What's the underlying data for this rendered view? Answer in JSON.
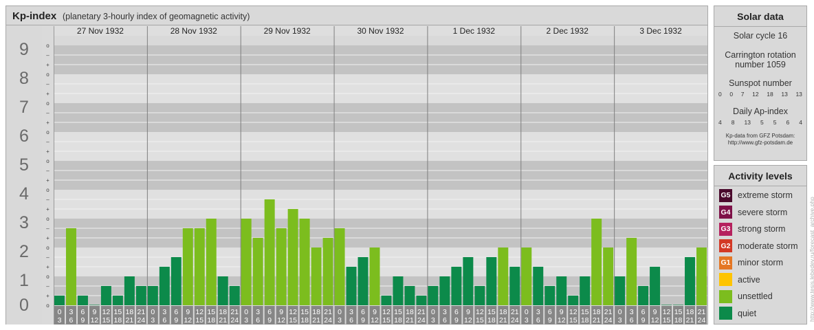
{
  "header": {
    "title": "Kp-index",
    "subtitle": "(planetary 3-hourly index of geomagnetic activity)"
  },
  "chart_data": {
    "type": "bar",
    "title": "Kp-index",
    "subtitle": "(planetary 3-hourly index of geomagnetic activity)",
    "ylim": [
      0,
      9
    ],
    "y_ticks": [
      "0",
      "1",
      "2",
      "3",
      "4",
      "5",
      "6",
      "7",
      "8",
      "9"
    ],
    "y_sub_ticks": [
      "o",
      "+",
      "–"
    ],
    "days": [
      "27 Nov 1932",
      "28 Nov 1932",
      "29 Nov 1932",
      "30 Nov 1932",
      "1 Dec 1932",
      "2 Dec 1932",
      "3 Dec 1932"
    ],
    "hour_starts": [
      "0",
      "3",
      "6",
      "9",
      "12",
      "15",
      "18",
      "21"
    ],
    "hour_ends": [
      "3",
      "6",
      "9",
      "12",
      "15",
      "18",
      "21",
      "24"
    ],
    "values": [
      [
        0.333,
        2.667,
        0.333,
        0.0,
        0.667,
        0.333,
        1.0,
        0.667
      ],
      [
        0.667,
        1.333,
        1.667,
        2.667,
        2.667,
        3.0,
        1.0,
        0.667
      ],
      [
        3.0,
        2.333,
        3.667,
        2.667,
        3.333,
        3.0,
        2.0,
        2.333
      ],
      [
        2.667,
        1.333,
        1.667,
        2.0,
        0.333,
        1.0,
        0.667,
        0.333
      ],
      [
        0.667,
        1.0,
        1.333,
        1.667,
        0.667,
        1.667,
        2.0,
        1.333
      ],
      [
        2.0,
        1.333,
        0.667,
        1.0,
        0.333,
        1.0,
        3.0,
        2.0
      ],
      [
        1.0,
        2.333,
        0.667,
        1.333,
        0.0,
        0.0,
        1.667,
        2.0
      ]
    ],
    "colors": {
      "quiet": "#0c8a4a",
      "unsettled": "#7cbd1e",
      "active": "#fec401",
      "minor": "#e47725",
      "moderate": "#d33925",
      "strong": "#b5215e",
      "severe": "#7e1148",
      "extreme": "#4a0a2c"
    }
  },
  "solar": {
    "title": "Solar data",
    "cycle": "Solar cycle 16",
    "carrington_1": "Carrington rotation",
    "carrington_2": "number 1059",
    "sunspot_label": "Sunspot number",
    "sunspot_values": [
      "0",
      "0",
      "7",
      "12",
      "18",
      "13",
      "13"
    ],
    "ap_label": "Daily Ap-index",
    "ap_values": [
      "4",
      "8",
      "13",
      "5",
      "5",
      "6",
      "4"
    ],
    "credit_1": "Kp-data from GFZ Potsdam:",
    "credit_2": "http://www.gfz-potsdam.de"
  },
  "activity": {
    "title": "Activity levels",
    "items": [
      {
        "code": "G5",
        "label": "extreme storm",
        "color": "#4a0a2c"
      },
      {
        "code": "G4",
        "label": "severe storm",
        "color": "#7e1148"
      },
      {
        "code": "G3",
        "label": "strong storm",
        "color": "#b5215e"
      },
      {
        "code": "G2",
        "label": "moderate storm",
        "color": "#d33925"
      },
      {
        "code": "G1",
        "label": "minor storm",
        "color": "#e47725"
      },
      {
        "code": "",
        "label": "active",
        "color": "#fec401"
      },
      {
        "code": "",
        "label": "unsettled",
        "color": "#7cbd1e"
      },
      {
        "code": "",
        "label": "quiet",
        "color": "#0c8a4a"
      }
    ]
  },
  "watermark": "http://www.tesis.lebedev.ru/forecast_archive.php"
}
